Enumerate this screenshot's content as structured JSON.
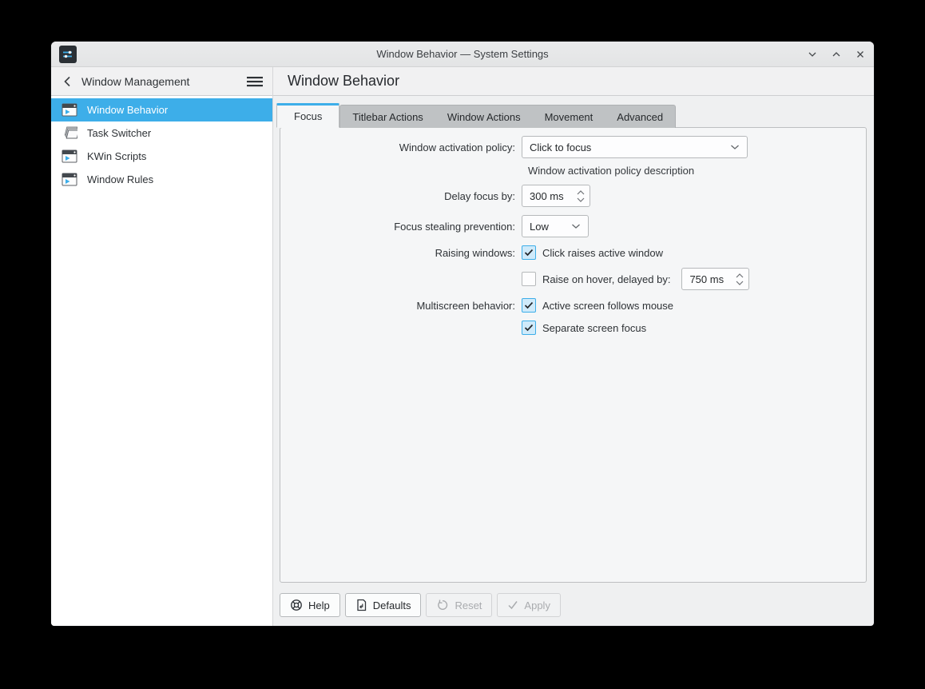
{
  "window": {
    "title": "Window Behavior — System Settings"
  },
  "sidebar": {
    "header_title": "Window Management",
    "items": [
      {
        "label": "Window Behavior",
        "icon": "window-behavior-icon",
        "selected": true
      },
      {
        "label": "Task Switcher",
        "icon": "task-switcher-icon",
        "selected": false
      },
      {
        "label": "KWin Scripts",
        "icon": "kwin-scripts-icon",
        "selected": false
      },
      {
        "label": "Window Rules",
        "icon": "window-rules-icon",
        "selected": false
      }
    ]
  },
  "main": {
    "page_title": "Window Behavior",
    "tabs": [
      {
        "label": "Focus",
        "active": true
      },
      {
        "label": "Titlebar Actions",
        "active": false
      },
      {
        "label": "Window Actions",
        "active": false
      },
      {
        "label": "Movement",
        "active": false
      },
      {
        "label": "Advanced",
        "active": false
      }
    ],
    "form": {
      "activation_policy": {
        "label": "Window activation policy:",
        "value": "Click to focus",
        "description": "Window activation policy description"
      },
      "delay_focus": {
        "label": "Delay focus by:",
        "value": "300 ms"
      },
      "focus_stealing": {
        "label": "Focus stealing prevention:",
        "value": "Low"
      },
      "raising_windows": {
        "label": "Raising windows:",
        "click_raises": {
          "label": "Click raises active window",
          "checked": true
        },
        "raise_on_hover": {
          "label": "Raise on hover, delayed by:",
          "checked": false,
          "value": "750 ms"
        }
      },
      "multiscreen": {
        "label": "Multiscreen behavior:",
        "active_screen_follows_mouse": {
          "label": "Active screen follows mouse",
          "checked": true
        },
        "separate_screen_focus": {
          "label": "Separate screen focus",
          "checked": true
        }
      }
    },
    "footer": {
      "help": "Help",
      "defaults": "Defaults",
      "reset": "Reset",
      "apply": "Apply"
    }
  },
  "colors": {
    "accent": "#3daee9",
    "selection_text": "#ffffff",
    "window_bg": "#eff0f1",
    "sidebar_bg": "#ffffff",
    "frame_bg": "#f5f6f7"
  }
}
